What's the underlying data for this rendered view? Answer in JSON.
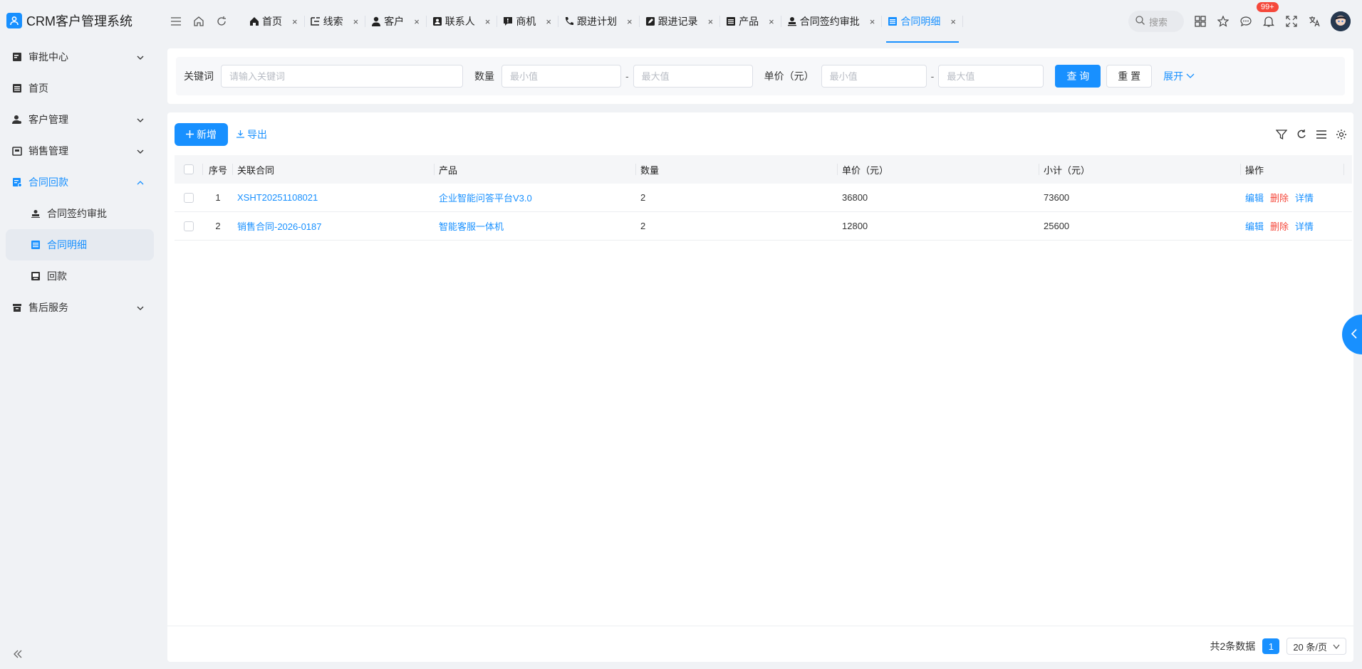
{
  "app": {
    "title": "CRM客户管理系统"
  },
  "sidebar": {
    "items": [
      {
        "label": "审批中心"
      },
      {
        "label": "首页"
      },
      {
        "label": "客户管理"
      },
      {
        "label": "销售管理"
      },
      {
        "label": "合同回款"
      },
      {
        "label": "合同签约审批"
      },
      {
        "label": "合同明细"
      },
      {
        "label": "回款"
      },
      {
        "label": "售后服务"
      }
    ]
  },
  "tabs": [
    {
      "label": "首页",
      "icon": "home-icon"
    },
    {
      "label": "线索",
      "icon": "tree-icon"
    },
    {
      "label": "客户",
      "icon": "user-icon"
    },
    {
      "label": "联系人",
      "icon": "contact-icon"
    },
    {
      "label": "商机",
      "icon": "opportunity-icon"
    },
    {
      "label": "跟进计划",
      "icon": "phone-icon"
    },
    {
      "label": "跟进记录",
      "icon": "edit-icon"
    },
    {
      "label": "产品",
      "icon": "doc-icon"
    },
    {
      "label": "合同签约审批",
      "icon": "stamp-icon"
    },
    {
      "label": "合同明细",
      "icon": "doc-icon"
    }
  ],
  "header": {
    "search_label": "搜索",
    "notification_badge": "99+"
  },
  "filter": {
    "keyword_label": "关键词",
    "keyword_placeholder": "请输入关键词",
    "qty_label": "数量",
    "min_placeholder": "最小值",
    "max_placeholder": "最大值",
    "price_label": "单价（元）",
    "dash": "-",
    "query_label": "查 询",
    "reset_label": "重 置",
    "expand_label": "展开"
  },
  "toolbar": {
    "add_label": "新增",
    "export_label": "导出"
  },
  "table": {
    "columns": {
      "index": "序号",
      "contract": "关联合同",
      "product": "产品",
      "qty": "数量",
      "price": "单价（元）",
      "subtotal": "小计（元）",
      "ops": "操作"
    },
    "rows": [
      {
        "index": "1",
        "contract": "XSHT20251108021",
        "product": "企业智能问答平台V3.0",
        "qty": "2",
        "price": "36800",
        "subtotal": "73600"
      },
      {
        "index": "2",
        "contract": "销售合同-2026-0187",
        "product": "智能客服一体机",
        "qty": "2",
        "price": "12800",
        "subtotal": "25600"
      }
    ],
    "ops": {
      "edit": "编辑",
      "delete": "删除",
      "detail": "详情"
    }
  },
  "pagination": {
    "total_text": "共2条数据",
    "current_page": "1",
    "page_size": "20 条/页"
  },
  "colors": {
    "primary": "#1890ff",
    "danger": "#f5483b"
  }
}
